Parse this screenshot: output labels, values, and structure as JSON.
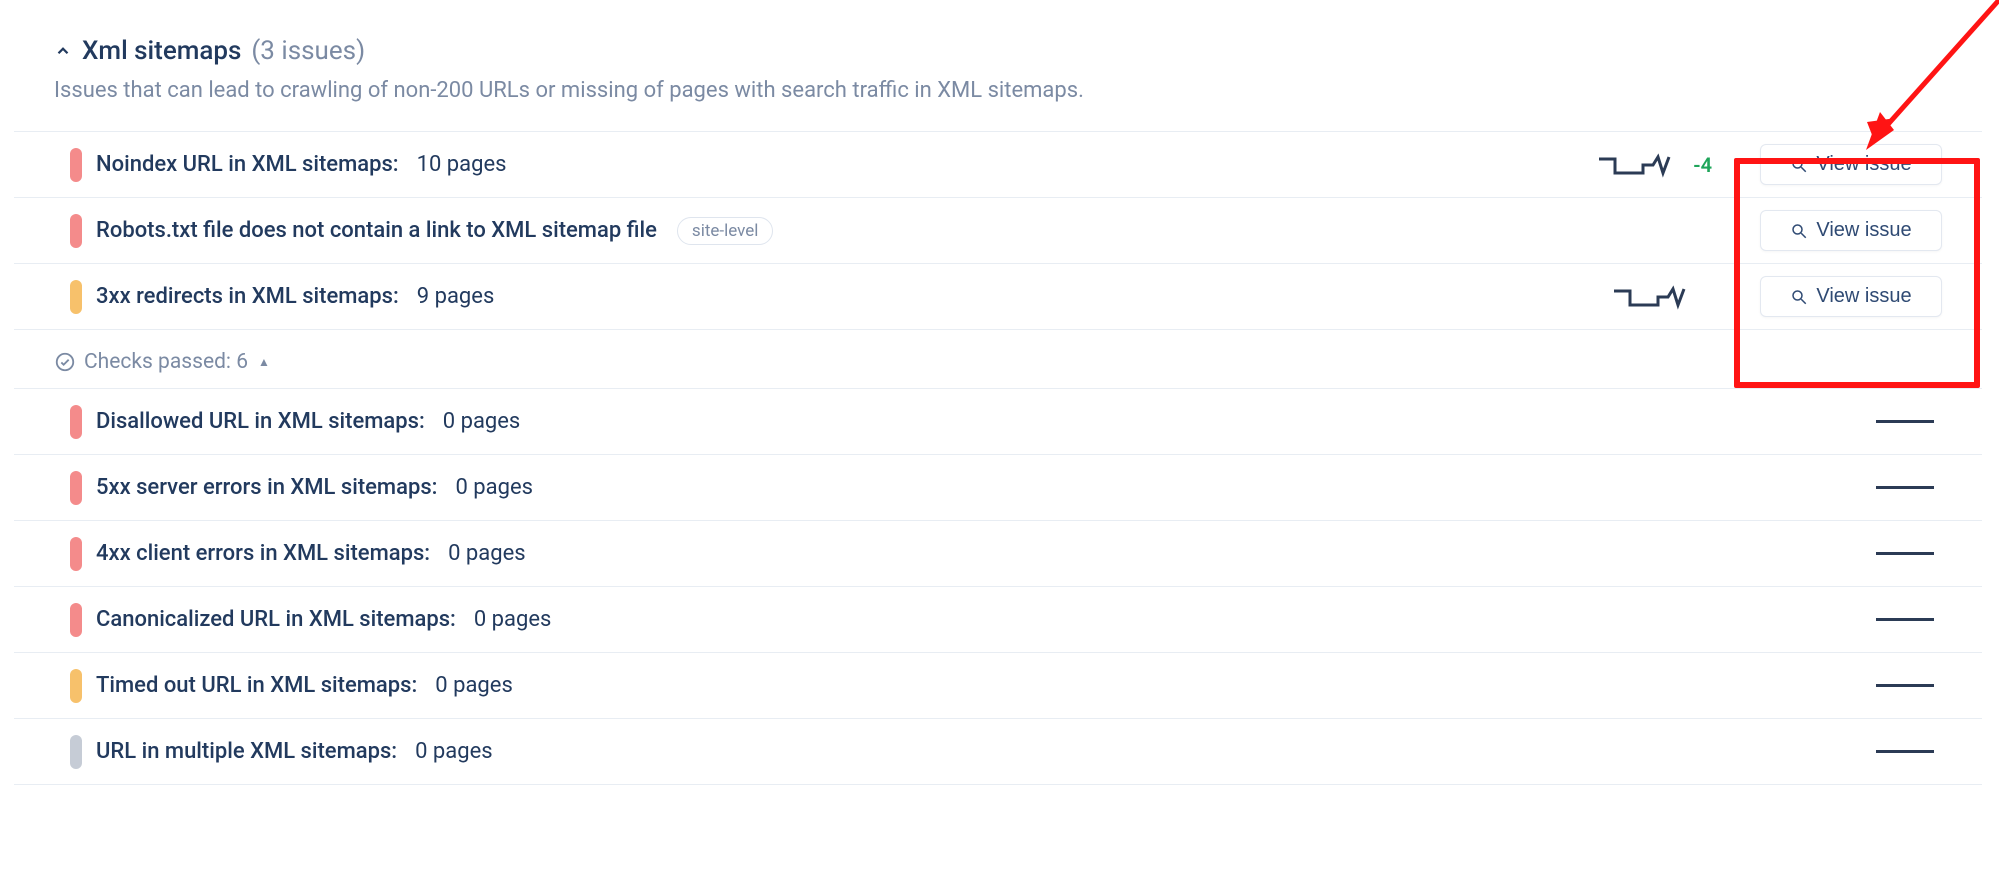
{
  "section": {
    "title": "Xml sitemaps",
    "issue_count_label": "(3 issues)",
    "description": "Issues that can lead to crawling of non-200 URLs or missing of pages with search traffic in XML sitemaps."
  },
  "issues": [
    {
      "severity": "red",
      "label": "Noindex URL in XML sitemaps:",
      "value": "10 pages",
      "spark": "step-up",
      "delta": "-4",
      "button": "View issue"
    },
    {
      "severity": "red",
      "label": "Robots.txt file does not contain a link to XML sitemap file",
      "value": "",
      "badge": "site-level",
      "button": "View issue"
    },
    {
      "severity": "orange",
      "label": "3xx redirects in XML sitemaps:",
      "value": "9 pages",
      "spark": "step-up",
      "button": "View issue"
    }
  ],
  "checks_passed": {
    "label": "Checks passed: 6"
  },
  "passed": [
    {
      "severity": "red",
      "label": "Disallowed URL in XML sitemaps:",
      "value": "0 pages"
    },
    {
      "severity": "red",
      "label": "5xx server errors in XML sitemaps:",
      "value": "0 pages"
    },
    {
      "severity": "red",
      "label": "4xx client errors in XML sitemaps:",
      "value": "0 pages"
    },
    {
      "severity": "red",
      "label": "Canonicalized URL in XML sitemaps:",
      "value": "0 pages"
    },
    {
      "severity": "orange",
      "label": "Timed out URL in XML sitemaps:",
      "value": "0 pages"
    },
    {
      "severity": "gray",
      "label": "URL in multiple XML sitemaps:",
      "value": "0 pages"
    }
  ]
}
